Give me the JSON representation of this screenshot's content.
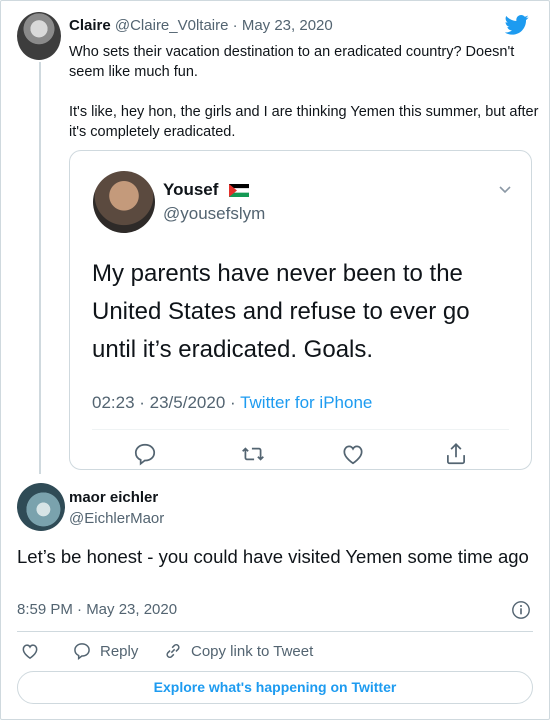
{
  "colors": {
    "accent": "#1d9bf0",
    "text": "#0f1419",
    "muted": "#536471",
    "border": "#cfd9de"
  },
  "parent_tweet": {
    "name": "Claire",
    "handle": "@Claire_V0ltaire",
    "date": "May 23, 2020",
    "paragraphs": [
      "Who sets their vacation destination to an eradicated country? Doesn't seem like much fun.",
      "It's like, hey hon, the girls and I are thinking Yemen this summer, but after it's completely eradicated."
    ]
  },
  "quoted_tweet": {
    "name": "Yousef",
    "handle": "@yousefslym",
    "text": "My parents have never been to the United States and refuse to ever go until it’s eradicated. Goals.",
    "timestamp": "02:23 · 23/5/2020 · ",
    "source": "Twitter for iPhone",
    "icons": [
      "chevron-down-icon",
      "reply-icon",
      "retweet-icon",
      "like-icon",
      "share-icon"
    ]
  },
  "reply_tweet": {
    "name": "maor eichler",
    "handle": "@EichlerMaor",
    "text": "Let’s be honest - you could have visited Yemen some time ago",
    "timestamp": "8:59 PM · May 23, 2020"
  },
  "actions": {
    "reply_label": "Reply",
    "copy_label": "Copy link to Tweet"
  },
  "explore_label": "Explore what's happening on Twitter"
}
